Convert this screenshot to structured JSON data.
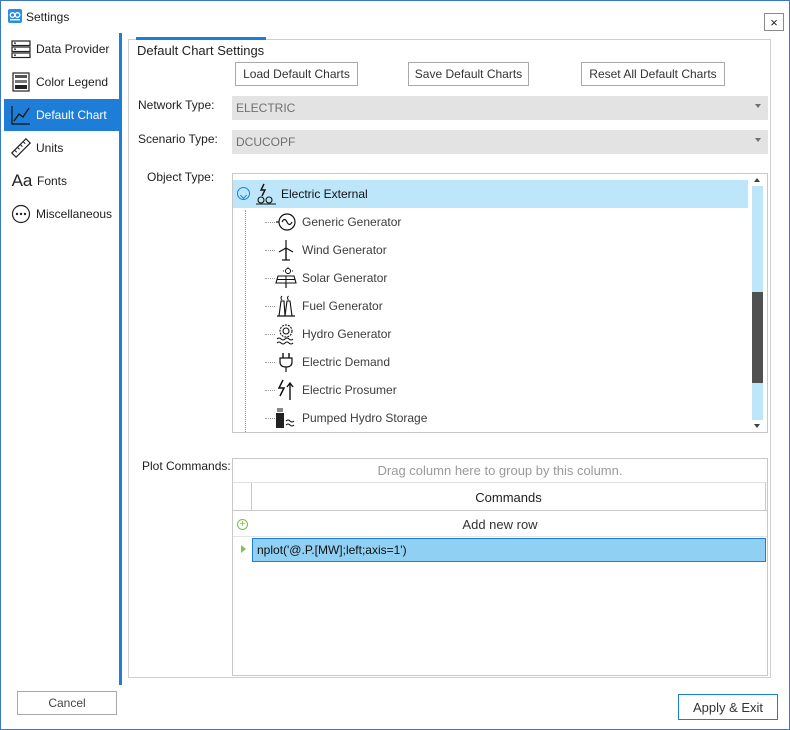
{
  "window": {
    "title": "Settings",
    "close_label": "×"
  },
  "sidebar": {
    "items": [
      {
        "label": "Data Provider",
        "icon": "server-stack-icon"
      },
      {
        "label": "Color Legend",
        "icon": "color-legend-icon"
      },
      {
        "label": "Default Chart",
        "icon": "line-chart-icon",
        "active": true
      },
      {
        "label": "Units",
        "icon": "ruler-icon"
      },
      {
        "label": "Fonts",
        "icon": "font-aa-icon"
      },
      {
        "label": "Miscellaneous",
        "icon": "ellipsis-circle-icon"
      }
    ]
  },
  "main": {
    "title": "Default Chart Settings",
    "buttons": {
      "load": "Load Default Charts",
      "save": "Save Default Charts",
      "reset": "Reset All Default Charts"
    },
    "network_type": {
      "label": "Network Type:",
      "value": "ELECTRIC"
    },
    "scenario_type": {
      "label": "Scenario Type:",
      "value": "DCUCOPF"
    },
    "object_type": {
      "label": "Object Type:",
      "root": {
        "label": "Electric External",
        "icon": "electric-external-icon",
        "expanded": true
      },
      "children": [
        {
          "label": "Generic Generator",
          "icon": "generic-generator-icon"
        },
        {
          "label": "Wind Generator",
          "icon": "wind-turbine-icon"
        },
        {
          "label": "Solar Generator",
          "icon": "solar-panel-icon"
        },
        {
          "label": "Fuel Generator",
          "icon": "fuel-plant-icon"
        },
        {
          "label": "Hydro Generator",
          "icon": "hydro-generator-icon"
        },
        {
          "label": "Electric Demand",
          "icon": "plug-icon"
        },
        {
          "label": "Electric Prosumer",
          "icon": "prosumer-icon"
        },
        {
          "label": "Pumped Hydro Storage",
          "icon": "pumped-hydro-icon"
        }
      ]
    },
    "plot_commands": {
      "label": "Plot Commands:",
      "group_panel_text": "Drag column here to group by this column.",
      "column_header": "Commands",
      "add_row_label": "Add new row",
      "rows": [
        "nplot('@.P.[MW];left;axis=1')"
      ]
    }
  },
  "footer": {
    "cancel_label": "Cancel",
    "apply_label": "Apply & Exit"
  },
  "colors": {
    "accent": "#1e7dd7",
    "selection": "#bde6fa",
    "row_selection": "#8fd0f3",
    "combo_bg": "#e3e3e3"
  }
}
